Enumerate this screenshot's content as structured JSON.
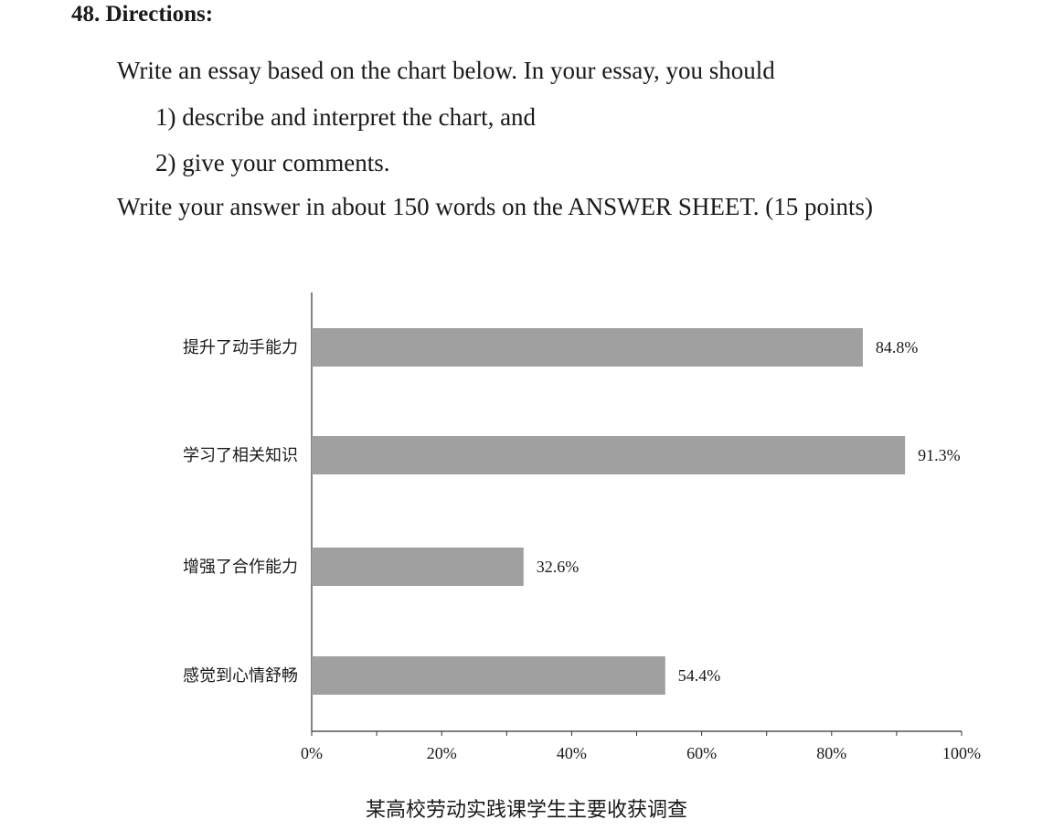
{
  "directions": {
    "heading": "48. Directions:",
    "line1": "Write an essay based on the chart below. In your essay, you should",
    "line2": "1) describe and interpret the chart, and",
    "line3": "2) give your comments.",
    "line4": "Write your answer in about 150 words on the ANSWER SHEET. (15 points)"
  },
  "chart_data": {
    "type": "bar",
    "orientation": "horizontal",
    "title": "某高校劳动实践课学生主要收获调查",
    "categories": [
      "提升了动手能力",
      "学习了相关知识",
      "增强了合作能力",
      "感觉到心情舒畅"
    ],
    "values": [
      84.8,
      91.3,
      32.6,
      54.4
    ],
    "value_labels": [
      "84.8%",
      "91.3%",
      "32.6%",
      "54.4%"
    ],
    "xlim": [
      0,
      100
    ],
    "xticks": [
      "0%",
      "20%",
      "40%",
      "60%",
      "80%",
      "100%"
    ],
    "xlabel": "",
    "ylabel": "",
    "grid": false,
    "legend": "none",
    "bar_color": "#a0a0a0"
  }
}
